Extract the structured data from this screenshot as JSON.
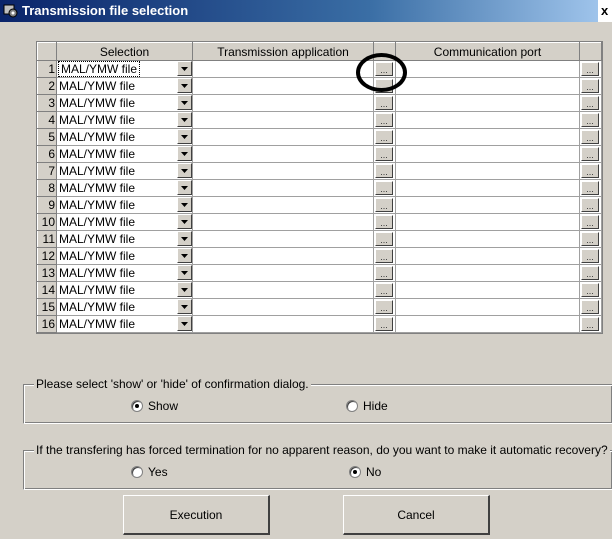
{
  "window": {
    "title": "Transmission file selection",
    "close_label": "x"
  },
  "grid": {
    "headers": {
      "selection": "Selection",
      "application": "Transmission application",
      "port": "Communication port"
    },
    "browse_label": "...",
    "rows": [
      {
        "num": "1",
        "selection": "MAL/YMW file",
        "application": "",
        "port": ""
      },
      {
        "num": "2",
        "selection": "MAL/YMW file",
        "application": "",
        "port": ""
      },
      {
        "num": "3",
        "selection": "MAL/YMW file",
        "application": "",
        "port": ""
      },
      {
        "num": "4",
        "selection": "MAL/YMW file",
        "application": "",
        "port": ""
      },
      {
        "num": "5",
        "selection": "MAL/YMW file",
        "application": "",
        "port": ""
      },
      {
        "num": "6",
        "selection": "MAL/YMW file",
        "application": "",
        "port": ""
      },
      {
        "num": "7",
        "selection": "MAL/YMW file",
        "application": "",
        "port": ""
      },
      {
        "num": "8",
        "selection": "MAL/YMW file",
        "application": "",
        "port": ""
      },
      {
        "num": "9",
        "selection": "MAL/YMW file",
        "application": "",
        "port": ""
      },
      {
        "num": "10",
        "selection": "MAL/YMW file",
        "application": "",
        "port": ""
      },
      {
        "num": "11",
        "selection": "MAL/YMW file",
        "application": "",
        "port": ""
      },
      {
        "num": "12",
        "selection": "MAL/YMW file",
        "application": "",
        "port": ""
      },
      {
        "num": "13",
        "selection": "MAL/YMW file",
        "application": "",
        "port": ""
      },
      {
        "num": "14",
        "selection": "MAL/YMW file",
        "application": "",
        "port": ""
      },
      {
        "num": "15",
        "selection": "MAL/YMW file",
        "application": "",
        "port": ""
      },
      {
        "num": "16",
        "selection": "MAL/YMW file",
        "application": "",
        "port": ""
      }
    ]
  },
  "confirm_group": {
    "legend": "Please select 'show' or 'hide' of confirmation dialog.",
    "options": [
      {
        "label": "Show",
        "selected": true
      },
      {
        "label": "Hide",
        "selected": false
      }
    ]
  },
  "recovery_group": {
    "legend": "If the transfering has forced termination for no apparent reason, do you want to make it automatic recovery?",
    "options": [
      {
        "label": "Yes",
        "selected": false
      },
      {
        "label": "No",
        "selected": true
      }
    ]
  },
  "buttons": {
    "execute": "Execution",
    "cancel": "Cancel"
  },
  "colors": {
    "face": "#d4d0c8",
    "title_start": "#0a246a",
    "title_end": "#a6caf0"
  },
  "icons": {
    "title": "app-gear-icon",
    "dropdown": "chevron-down-icon"
  }
}
